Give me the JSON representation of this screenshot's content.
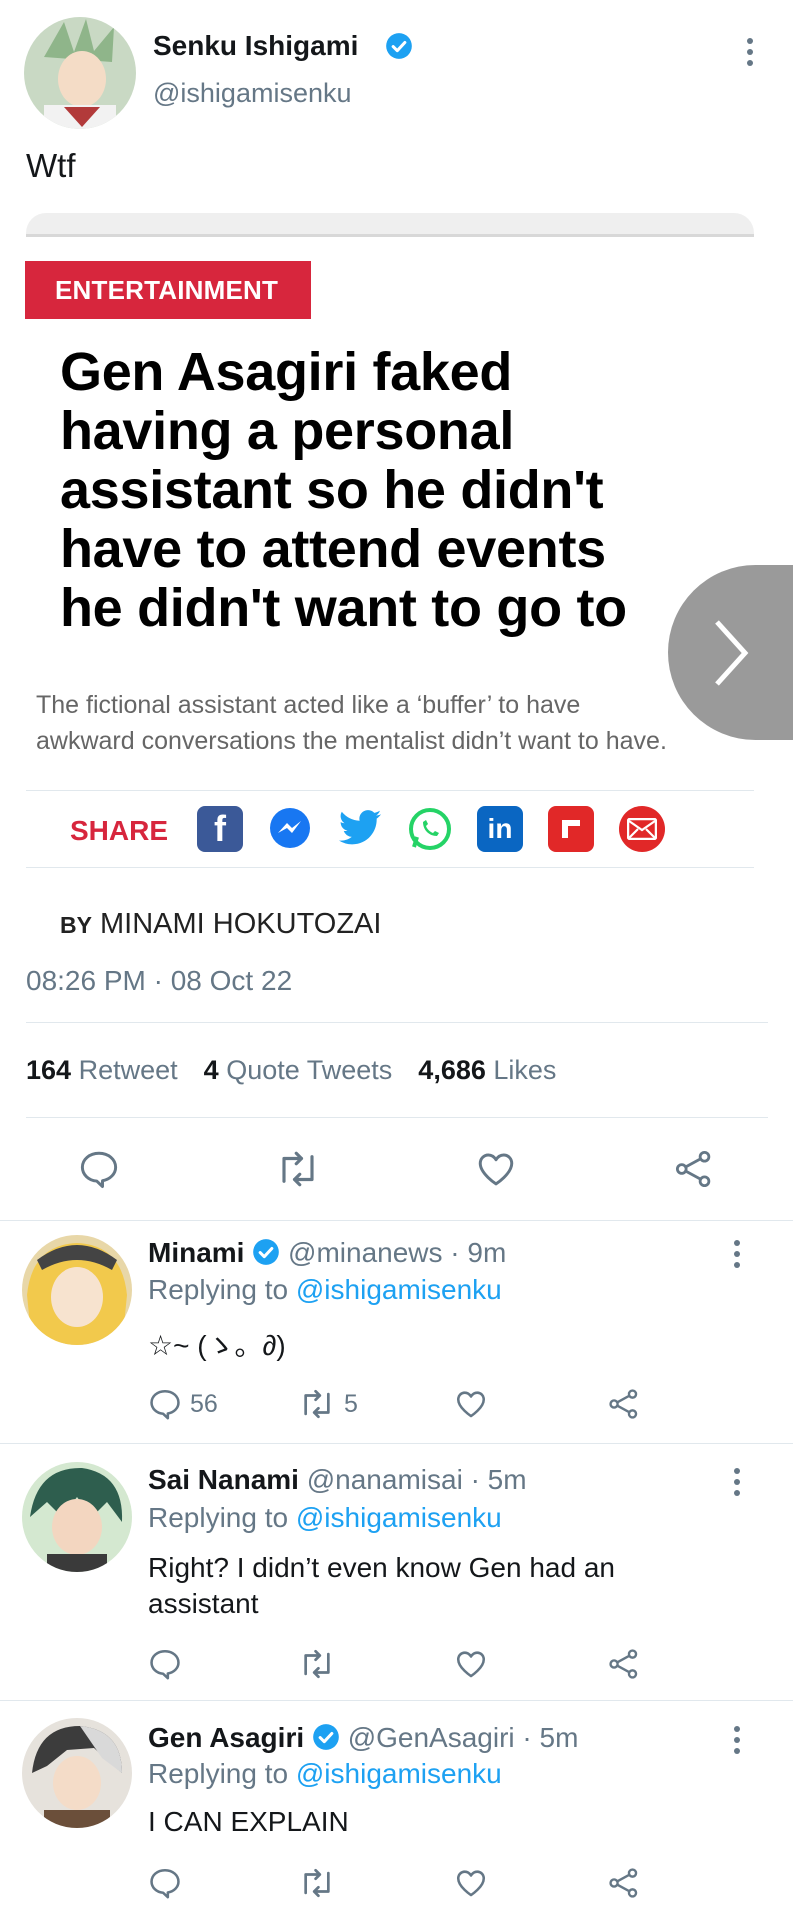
{
  "tweet": {
    "author_name": "Senku Ishigami",
    "handle": "@ishigamisenku",
    "text": "Wtf",
    "timestamp": "08:26 PM · 08 Oct 22",
    "stats": {
      "retweets": "164",
      "retweet_label": "Retweet",
      "quotes": "4",
      "quotes_label": "Quote Tweets",
      "likes": "4,686",
      "likes_label": "Likes"
    }
  },
  "article": {
    "category": "ENTERTAINMENT",
    "headline_lines": [
      "Gen Asagiri faked",
      "having a personal",
      "assistant so he didn't",
      "have to attend events",
      "he didn't want to go to"
    ],
    "subline_lines": [
      "The fictional assistant acted like a ‘buffer’ to have",
      "awkward conversations the mentalist didn’t want to have."
    ],
    "share_label": "SHARE",
    "byline_prefix": "BY",
    "byline_author": "MINAMI HOKUTOZAI",
    "share_icons": [
      "facebook-icon",
      "messenger-icon",
      "twitter-icon",
      "whatsapp-icon",
      "linkedin-icon",
      "flipboard-icon",
      "email-icon"
    ]
  },
  "replies": [
    {
      "name": "Minami",
      "verified": true,
      "handle": "@minanews",
      "time": "· 9m",
      "replying_prefix": "Replying to",
      "replying_to": "@ishigamisenku",
      "text": "☆~ (ゝ。∂)",
      "reply_count": "56",
      "retweet_count": "5"
    },
    {
      "name": "Sai Nanami",
      "verified": false,
      "handle": "@nanamisai",
      "time": "· 5m",
      "replying_prefix": "Replying to",
      "replying_to": "@ishigamisenku",
      "text_lines": [
        "Right? I didn’t even know Gen had an",
        "assistant"
      ]
    },
    {
      "name": "Gen Asagiri",
      "verified": true,
      "handle": "@GenAsagiri",
      "time": "· 5m",
      "replying_prefix": "Replying to",
      "replying_to": "@ishigamisenku",
      "text": "I CAN EXPLAIN"
    }
  ],
  "colors": {
    "accent": "#1da1f2",
    "category_red": "#d7263d",
    "muted": "#657786"
  }
}
